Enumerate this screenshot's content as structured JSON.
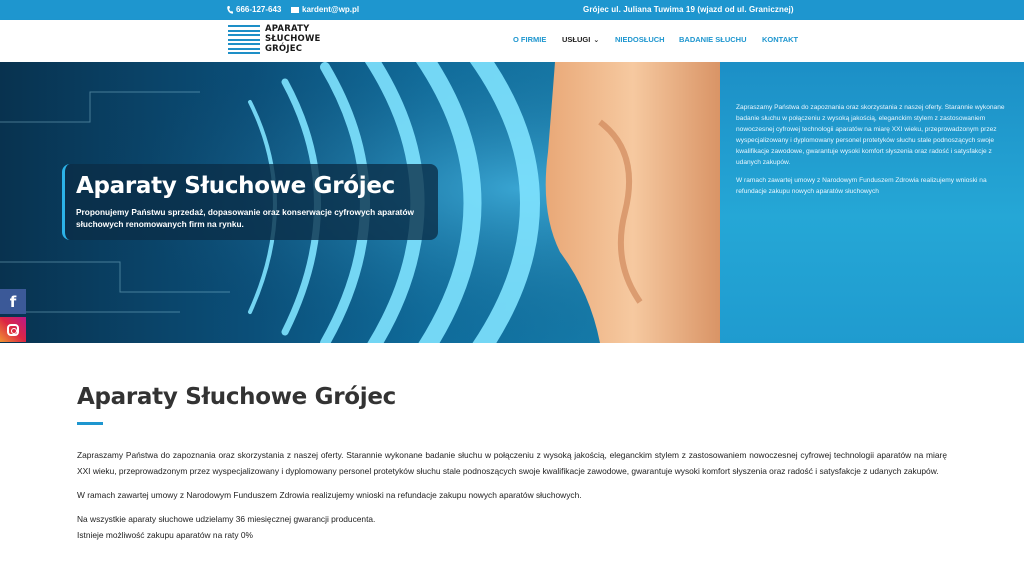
{
  "topbar": {
    "phone": "666-127-643",
    "email": "kardent@wp.pl",
    "address": "Grójec ul. Juliana Tuwima 19 (wjazd od ul. Granicznej)"
  },
  "logo": {
    "line1": "APARATY",
    "line2": "SŁUCHOWE",
    "line3": "GRÓJEC"
  },
  "nav": {
    "items": [
      {
        "label": "O FIRMIE"
      },
      {
        "label": "USŁUGI"
      },
      {
        "label": "NIEDOSŁUCH"
      },
      {
        "label": "BADANIE SŁUCHU"
      },
      {
        "label": "KONTAKT"
      }
    ]
  },
  "hero": {
    "title": "Aparaty Słuchowe Grójec",
    "subtitle": "Proponujemy Państwu sprzedaż, dopasowanie oraz konserwacje cyfrowych aparatów słuchowych renomowanych firm na rynku.",
    "side_p1": "Zapraszamy Państwa do zapoznania oraz skorzystania z naszej oferty. Starannie wykonane badanie słuchu w połączeniu z wysoką jakością, eleganckim stylem z zastosowaniem nowoczesnej cyfrowej technologii aparatów na miarę XXI wieku, przeprowadzonym przez wyspecjalizowany i dyplomowany personel protetyków słuchu stale podnoszących swoje kwalifikacje zawodowe, gwarantuje wysoki komfort słyszenia oraz radość i satysfakcje z udanych zakupów.",
    "side_p2": "W ramach zawartej umowy z Narodowym Funduszem Zdrowia realizujemy wnioski na refundacje zakupu nowych aparatów słuchowych"
  },
  "social": {
    "facebook_icon": "facebook-icon",
    "instagram_icon": "instagram-icon",
    "facebook_glyph": "f"
  },
  "content": {
    "heading": "Aparaty Słuchowe Grójec",
    "p1": "Zapraszamy Państwa do zapoznania oraz skorzystania z naszej oferty. Starannie wykonane badanie słuchu w połączeniu z wysoką jakością, eleganckim stylem z zastosowaniem nowoczesnej cyfrowej technologii aparatów na miarę XXI wieku, przeprowadzonym przez wyspecjalizowany i dyplomowany personel protetyków słuchu stale podnoszących swoje kwalifikacje zawodowe, gwarantuje wysoki komfort słyszenia oraz radość i satysfakcje z udanych zakupów.",
    "p2": "W ramach zawartej umowy z Narodowym Funduszem Zdrowia realizujemy wnioski na refundacje zakupu nowych aparatów słuchowych.",
    "p3_line1": "Na wszystkie aparaty słuchowe udzielamy 36 miesięcznej gwarancji producenta.",
    "p3_line2": "Istnieje możliwość zakupu aparatów na raty 0%"
  },
  "colors": {
    "accent": "#1e96cf",
    "facebook": "#3b5998"
  }
}
